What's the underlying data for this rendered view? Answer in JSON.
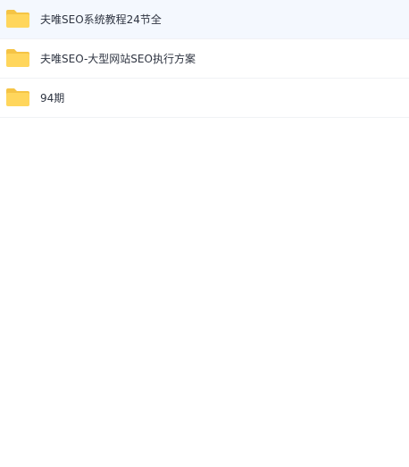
{
  "files": [
    {
      "name": "夫唯SEO系统教程24节全",
      "icon": "folder-icon",
      "selected": true
    },
    {
      "name": "夫唯SEO-大型网站SEO执行方案",
      "icon": "folder-icon",
      "selected": false
    },
    {
      "name": "94期",
      "icon": "folder-icon",
      "selected": false
    }
  ],
  "colors": {
    "folder_body": "#ffd65c",
    "folder_tab": "#f5c445",
    "selected_row": "#f4f8fe",
    "divider": "#f0f2f5"
  }
}
